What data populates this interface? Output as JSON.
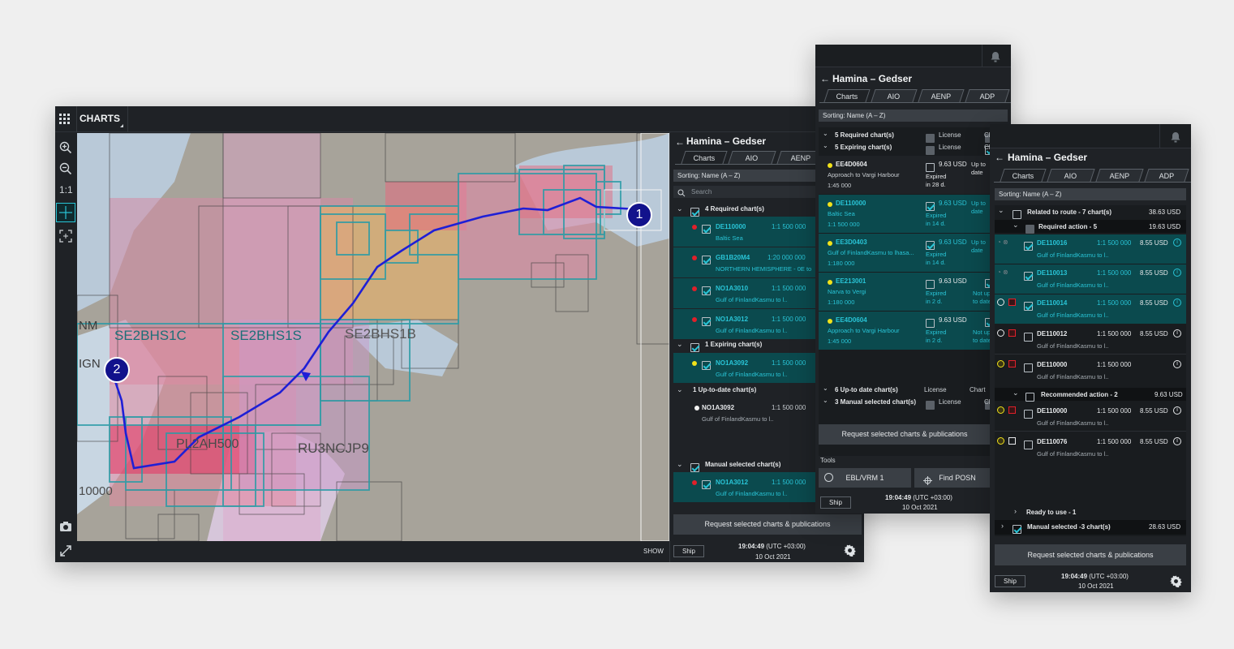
{
  "colors": {
    "accent": "#29c4d6",
    "route": "#1f1fd6",
    "panel": "#1f2226",
    "selected_row": "#0b4a4e",
    "red": "#e0202a",
    "yellow": "#f2e21a"
  },
  "toolbar": {
    "menu_icon": "grid-icon",
    "title": "CHARTS"
  },
  "map_tools": {
    "zoom_in": "zoom-in-icon",
    "zoom_out": "zoom-out-icon",
    "one_to_one": "1:1",
    "center": "crosshair-icon",
    "fit": "fit-icon",
    "camera": "camera-icon",
    "expand": "expand-icon"
  },
  "map": {
    "labels": [
      "NM",
      "SE2BHS1C",
      "SE2BHS1S",
      "SE2BHS1B",
      "IGN",
      "PL2AH500",
      "RU3NCJP9",
      "10000"
    ],
    "waypoints": [
      {
        "label": "1"
      },
      {
        "label": "2"
      }
    ],
    "show_label": "SHOW"
  },
  "panel1": {
    "title": "Hamina – Gedser",
    "tabs": [
      "Charts",
      "AIO",
      "AENP"
    ],
    "sorting": "Sorting: Name (A – Z)",
    "search_placeholder": "Search",
    "groups": [
      {
        "label": "4 Required chart(s)",
        "checked": true,
        "items": [
          {
            "name": "DE110000",
            "scale": "1:1 500 000",
            "sub": "Baltic Sea",
            "dot": "red",
            "checked": true
          },
          {
            "name": "GB1B20M4",
            "scale": "1:20 000 000",
            "sub": "NORTHERN HEMISPHERE - 0E to",
            "dot": "red",
            "checked": true
          },
          {
            "name": "NO1A3010",
            "scale": "1:1 500 000",
            "sub": "Gulf of FinlandKasmu to l..",
            "dot": "red",
            "checked": true
          },
          {
            "name": "NO1A3012",
            "scale": "1:1 500 000",
            "sub": "Gulf of FinlandKasmu to l..",
            "dot": "red",
            "checked": true
          }
        ]
      },
      {
        "label": "1 Expiring chart(s)",
        "checked": true,
        "items": [
          {
            "name": "NO1A3092",
            "scale": "1:1 500 000",
            "sub": "Gulf of FinlandKasmu to l..",
            "dot": "yellow",
            "checked": true
          }
        ]
      },
      {
        "label": "1 Up-to-date chart(s)",
        "checked": false,
        "items": [
          {
            "name": "NO1A3092",
            "scale": "1:1 500 000",
            "sub": "Gulf of FinlandKasmu to l..",
            "dot": "white",
            "checked": false
          }
        ]
      },
      {
        "label": "Manual selected chart(s)",
        "checked": true,
        "items": [
          {
            "name": "NO1A3012",
            "scale": "1:1 500 000",
            "sub": "Gulf of FinlandKasmu to l..",
            "dot": "red",
            "checked": true
          }
        ]
      }
    ],
    "request_button": "Request selected charts & publications",
    "ship": "Ship",
    "time": "19:04:49",
    "utc": "(UTC +03:00)",
    "date": "10 Oct 2021"
  },
  "panel2": {
    "title": "Hamina – Gedser",
    "tabs": [
      "Charts",
      "AIO",
      "AENP",
      "ADP"
    ],
    "sorting": "Sorting: Name (A – Z)",
    "headers": [
      {
        "label": "5 Required chart(s)",
        "col1": "License",
        "col2": "Cha"
      },
      {
        "label": "5 Expiring chart(s)",
        "col1": "License",
        "col2": "Cha"
      }
    ],
    "items": [
      {
        "name": "EE4D0604",
        "sub": "Approach to Vargi Harbour",
        "scale": "1:45 000",
        "price": "9.63 USD",
        "status1": "Expired",
        "status2": "in 28 d.",
        "status3": "Up to",
        "status4": "date",
        "checked": false,
        "selected": false
      },
      {
        "name": "DE110000",
        "sub": "Baltic Sea",
        "scale": "1:1 500 000",
        "price": "9.63 USD",
        "status1": "Expired",
        "status2": "in 14 d.",
        "status3": "Up to",
        "status4": "date",
        "checked": true,
        "selected": true
      },
      {
        "name": "EE3D0403",
        "sub": "Gulf of FinlandKasmu to lhasa...",
        "scale": "1:180 000",
        "price": "9.63 USD",
        "status1": "Expired",
        "status2": "in 14 d.",
        "status3": "Up to",
        "status4": "date",
        "checked": true,
        "selected": true
      },
      {
        "name": "EE213001",
        "sub": "Narva to Vergi",
        "scale": "1:180 000",
        "price": "9.63 USD",
        "status1": "Expired",
        "status2": "in 2 d.",
        "status3": "Not up",
        "status4": "to date",
        "checked": false,
        "selected": true
      },
      {
        "name": "EE4D0604",
        "sub": "Approach to Vargi Harbour",
        "scale": "1:45 000",
        "price": "9.63 USD",
        "status1": "Expired",
        "status2": "in 2 d.",
        "status3": "Not up",
        "status4": "to date",
        "checked": false,
        "selected": true
      }
    ],
    "footer_groups": [
      {
        "label": "6 Up-to date chart(s)",
        "col1": "License",
        "col2": "Chart"
      },
      {
        "label": "3 Manual selected chart(s)",
        "col1": "License",
        "col2": "Cha"
      }
    ],
    "request_button": "Request selected charts & publications",
    "tools_label": "Tools",
    "tool1": "EBL/VRM 1",
    "tool2": "Find POSN",
    "ship": "Ship",
    "time": "19:04:49",
    "utc": "(UTC +03:00)",
    "date": "10 Oct 2021"
  },
  "panel3": {
    "title": "Hamina – Gedser",
    "tabs": [
      "Charts",
      "AIO",
      "AENP",
      "ADP"
    ],
    "sorting": "Sorting: Name (A – Z)",
    "related": {
      "label": "Related to route - 7 chart(s)",
      "price": "38.63 USD"
    },
    "required": {
      "label": "Required action - 5",
      "price": "19.63 USD"
    },
    "required_items": [
      {
        "name": "DE110016",
        "scale": "1:1 500 000",
        "price": "8.55 USD",
        "sub": "Gulf of FinlandKasmu to l..",
        "checked": true,
        "selected": true
      },
      {
        "name": "DE110013",
        "scale": "1:1 500 000",
        "price": "8.55 USD",
        "sub": "Gulf of FinlandKasmu to l..",
        "checked": true,
        "selected": true
      },
      {
        "name": "DE110014",
        "scale": "1:1 500 000",
        "price": "8.55 USD",
        "sub": "Gulf of FinlandKasmu to l..",
        "checked": true,
        "selected": true
      },
      {
        "name": "DE110012",
        "scale": "1:1 500 000",
        "price": "8.55 USD",
        "sub": "Gulf of FinlandKasmu to l..",
        "checked": false,
        "selected": false
      },
      {
        "name": "DE110000",
        "scale": "1:1 500 000",
        "price": "",
        "sub": "Gulf of FinlandKasmu to l..",
        "checked": false,
        "selected": false
      }
    ],
    "recommended": {
      "label": "Recommended action - 2",
      "price": "9.63 USD"
    },
    "recommended_items": [
      {
        "name": "DE110000",
        "scale": "1:1 500 000",
        "price": "8.55 USD",
        "sub": "Gulf of FinlandKasmu to l.."
      },
      {
        "name": "DE110076",
        "scale": "1:1 500 000",
        "price": "8.55 USD",
        "sub": "Gulf of FinlandKasmu to l.."
      }
    ],
    "ready": "Ready to use - 1",
    "manual": {
      "label": "Manual selected -3 chart(s)",
      "price": "28.63 USD"
    },
    "request_button": "Request selected charts & publications",
    "ship": "Ship",
    "time": "19:04:49",
    "utc": "(UTC +03:00)",
    "date": "10 Oct 2021"
  }
}
